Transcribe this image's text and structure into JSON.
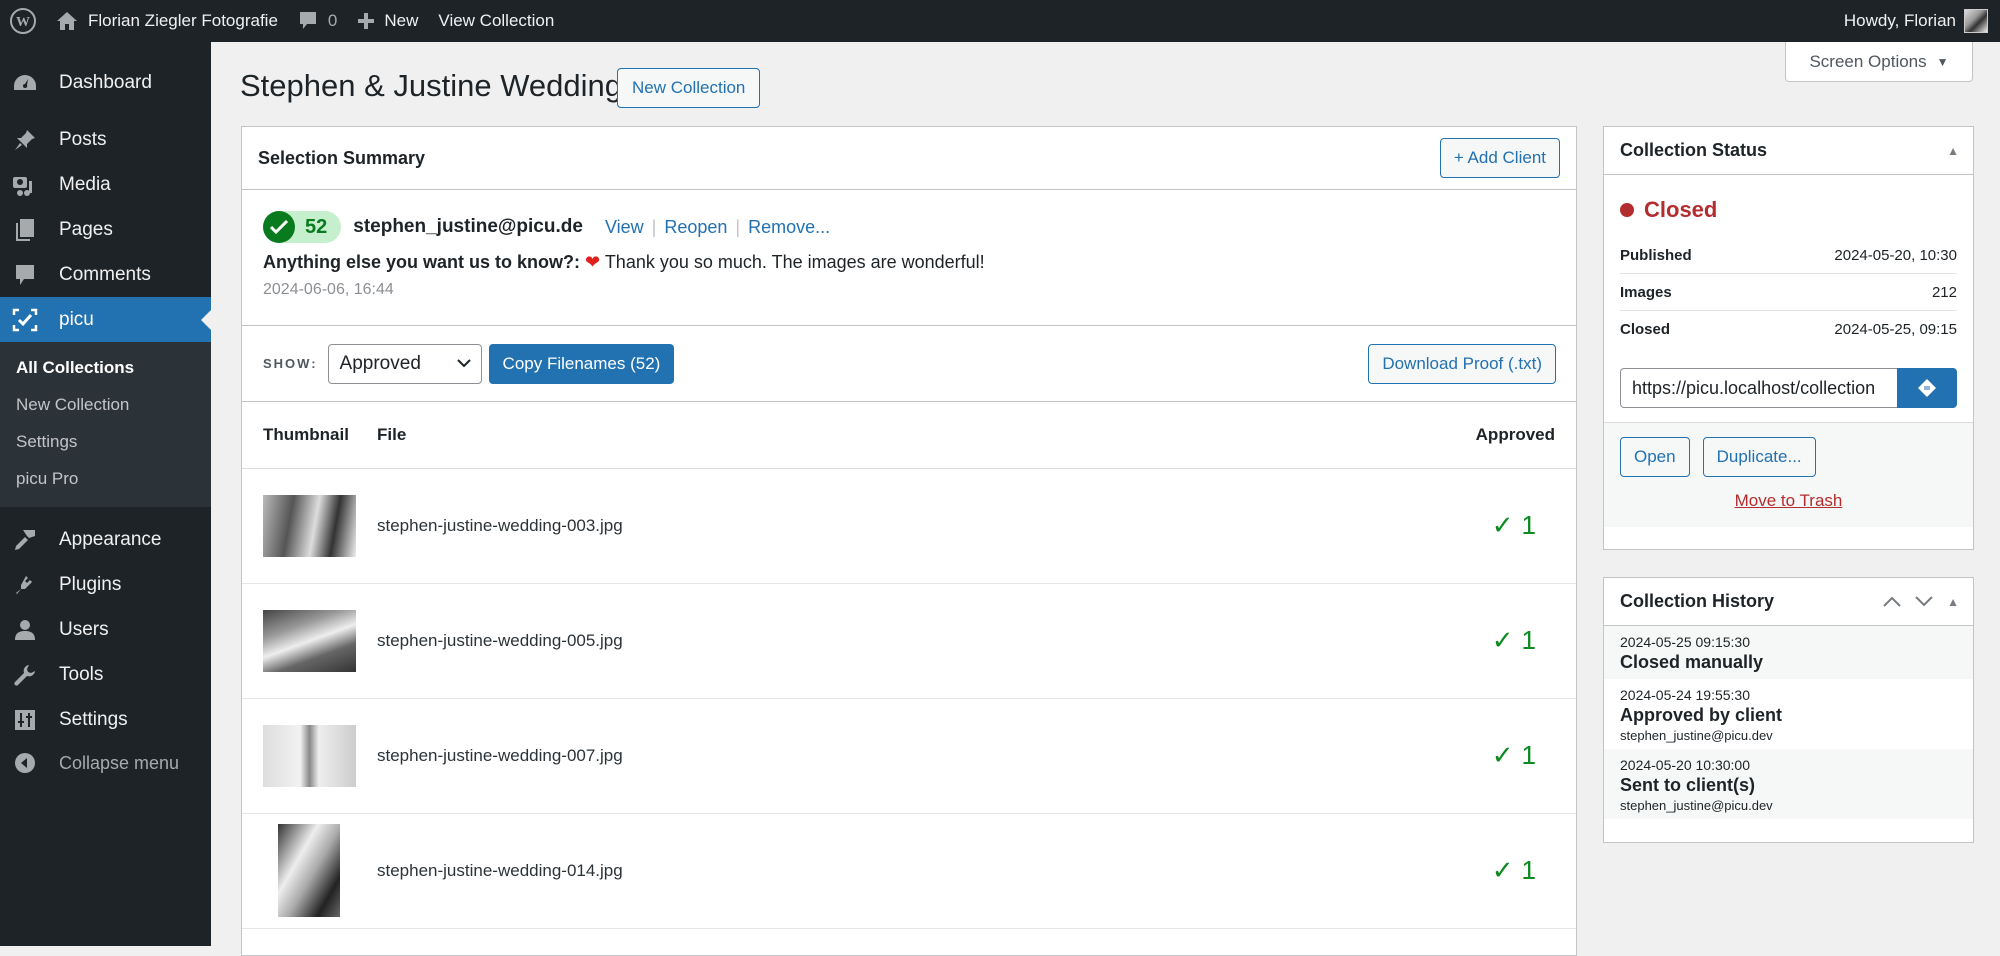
{
  "adminbar": {
    "site_name": "Florian Ziegler Fotografie",
    "comments_count": "0",
    "new_label": "New",
    "view_collection_label": "View Collection",
    "howdy": "Howdy, Florian"
  },
  "screen_options": "Screen Options",
  "sidebar": {
    "items": [
      {
        "label": "Dashboard",
        "icon": "dashboard-icon"
      },
      {
        "label": "Posts",
        "icon": "pin-icon"
      },
      {
        "label": "Media",
        "icon": "media-icon"
      },
      {
        "label": "Pages",
        "icon": "pages-icon"
      },
      {
        "label": "Comments",
        "icon": "comment-icon"
      },
      {
        "label": "picu",
        "icon": "picu-icon",
        "active": true
      },
      {
        "label": "Appearance",
        "icon": "brush-icon"
      },
      {
        "label": "Plugins",
        "icon": "plugin-icon"
      },
      {
        "label": "Users",
        "icon": "user-icon"
      },
      {
        "label": "Tools",
        "icon": "wrench-icon"
      },
      {
        "label": "Settings",
        "icon": "settings-icon"
      }
    ],
    "submenu": [
      "All Collections",
      "New Collection",
      "Settings",
      "picu Pro"
    ],
    "collapse_label": "Collapse menu"
  },
  "page": {
    "title": "Stephen & Justine Wedding",
    "new_collection_label": "New Collection"
  },
  "summary": {
    "title": "Selection Summary",
    "add_client_label": "+ Add Client",
    "client": {
      "approved_count": "52",
      "email": "stephen_justine@picu.de",
      "links": [
        "View",
        "Reopen",
        "Remove..."
      ],
      "message_label": "Anything else you want us to know?:",
      "message_text": "Thank you so much. The images are wonderful!",
      "date": "2024-06-06, 16:44"
    },
    "toolbar": {
      "show_label": "SHOW:",
      "filter_value": "Approved",
      "copy_label": "Copy Filenames (52)",
      "download_label": "Download Proof (.txt)"
    },
    "table": {
      "headers": [
        "Thumbnail",
        "File",
        "Approved"
      ],
      "rows": [
        {
          "file": "stephen-justine-wedding-003.jpg",
          "approved": "1"
        },
        {
          "file": "stephen-justine-wedding-005.jpg",
          "approved": "1"
        },
        {
          "file": "stephen-justine-wedding-007.jpg",
          "approved": "1"
        },
        {
          "file": "stephen-justine-wedding-014.jpg",
          "approved": "1"
        }
      ]
    }
  },
  "status_box": {
    "title": "Collection Status",
    "status": "Closed",
    "status_color": "#b32d2e",
    "meta": [
      {
        "key": "Published",
        "value": "2024-05-20, 10:30"
      },
      {
        "key": "Images",
        "value": "212"
      },
      {
        "key": "Closed",
        "value": "2024-05-25, 09:15"
      }
    ],
    "url": "https://picu.localhost/collection",
    "open_label": "Open",
    "duplicate_label": "Duplicate...",
    "trash_label": "Move to Trash"
  },
  "history_box": {
    "title": "Collection History",
    "items": [
      {
        "ts": "2024-05-25 09:15:30",
        "event": "Closed manually",
        "who": ""
      },
      {
        "ts": "2024-05-24 19:55:30",
        "event": "Approved by client",
        "who": "stephen_justine@picu.dev"
      },
      {
        "ts": "2024-05-20 10:30:00",
        "event": "Sent to client(s)",
        "who": "stephen_justine@picu.dev"
      }
    ]
  },
  "colors": {
    "accent": "#2271b1",
    "approved_green": "#0a7a1f",
    "danger": "#b32d2e"
  }
}
